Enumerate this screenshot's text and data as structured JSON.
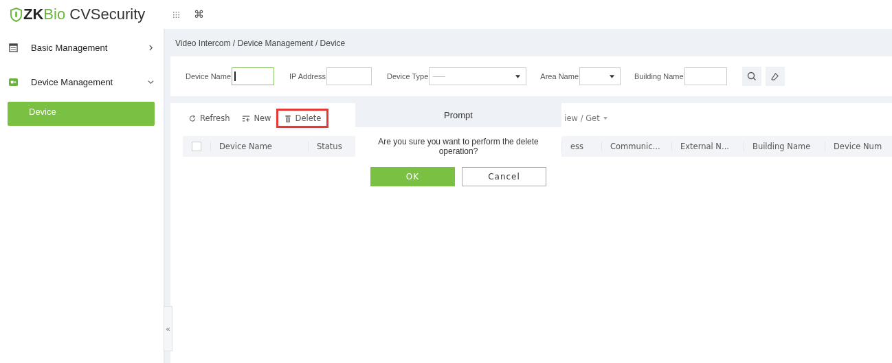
{
  "header": {
    "logo": {
      "prefix": "ZK",
      "accent": "Bio",
      "suffix": " CVSecurity"
    },
    "shortcut_glyph": "⌘"
  },
  "sidebar": {
    "items": [
      {
        "label": "Basic Management",
        "expanded": false
      },
      {
        "label": "Device Management",
        "expanded": true,
        "children": [
          {
            "label": "Device",
            "selected": true
          }
        ]
      }
    ]
  },
  "breadcrumb": "Video Intercom / Device Management / Device",
  "filters": [
    {
      "label": "Device Name",
      "kind": "text",
      "focused": true
    },
    {
      "label": "IP Address",
      "kind": "text",
      "focused": false
    },
    {
      "label": "Device Type",
      "kind": "select",
      "value": "---------"
    },
    {
      "label": "Area Name",
      "kind": "select"
    },
    {
      "label": "Building Name",
      "kind": "text",
      "focused": false
    }
  ],
  "toolbar": [
    {
      "label": "Refresh",
      "kind": "refresh",
      "highlighted": false
    },
    {
      "label": "New",
      "kind": "new",
      "highlighted": false
    },
    {
      "label": "Delete",
      "kind": "delete",
      "highlighted": true
    },
    {
      "label": "iew / Get",
      "kind": "menu",
      "highlighted": false
    }
  ],
  "table": {
    "select_all_checked": false,
    "columns": [
      "Device Name",
      "Status",
      "ess",
      "Communic...",
      "External N...",
      "Building Name",
      "Device Num"
    ]
  },
  "dialog": {
    "title": "Prompt",
    "message": "Are you sure you want to perform the delete operation?",
    "buttons": [
      {
        "label": "OK",
        "kind": "primary"
      },
      {
        "label": "Cancel",
        "kind": "secondary"
      }
    ]
  },
  "collapse_glyph": "«"
}
